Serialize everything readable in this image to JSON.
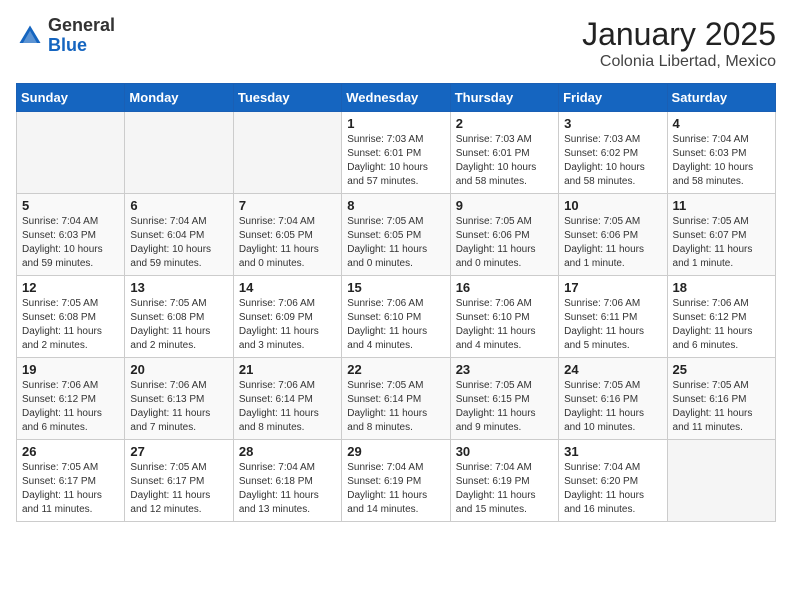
{
  "header": {
    "logo_general": "General",
    "logo_blue": "Blue",
    "month_title": "January 2025",
    "location": "Colonia Libertad, Mexico"
  },
  "weekdays": [
    "Sunday",
    "Monday",
    "Tuesday",
    "Wednesday",
    "Thursday",
    "Friday",
    "Saturday"
  ],
  "weeks": [
    [
      {
        "day": "",
        "info": ""
      },
      {
        "day": "",
        "info": ""
      },
      {
        "day": "",
        "info": ""
      },
      {
        "day": "1",
        "info": "Sunrise: 7:03 AM\nSunset: 6:01 PM\nDaylight: 10 hours and 57 minutes."
      },
      {
        "day": "2",
        "info": "Sunrise: 7:03 AM\nSunset: 6:01 PM\nDaylight: 10 hours and 58 minutes."
      },
      {
        "day": "3",
        "info": "Sunrise: 7:03 AM\nSunset: 6:02 PM\nDaylight: 10 hours and 58 minutes."
      },
      {
        "day": "4",
        "info": "Sunrise: 7:04 AM\nSunset: 6:03 PM\nDaylight: 10 hours and 58 minutes."
      }
    ],
    [
      {
        "day": "5",
        "info": "Sunrise: 7:04 AM\nSunset: 6:03 PM\nDaylight: 10 hours and 59 minutes."
      },
      {
        "day": "6",
        "info": "Sunrise: 7:04 AM\nSunset: 6:04 PM\nDaylight: 10 hours and 59 minutes."
      },
      {
        "day": "7",
        "info": "Sunrise: 7:04 AM\nSunset: 6:05 PM\nDaylight: 11 hours and 0 minutes."
      },
      {
        "day": "8",
        "info": "Sunrise: 7:05 AM\nSunset: 6:05 PM\nDaylight: 11 hours and 0 minutes."
      },
      {
        "day": "9",
        "info": "Sunrise: 7:05 AM\nSunset: 6:06 PM\nDaylight: 11 hours and 0 minutes."
      },
      {
        "day": "10",
        "info": "Sunrise: 7:05 AM\nSunset: 6:06 PM\nDaylight: 11 hours and 1 minute."
      },
      {
        "day": "11",
        "info": "Sunrise: 7:05 AM\nSunset: 6:07 PM\nDaylight: 11 hours and 1 minute."
      }
    ],
    [
      {
        "day": "12",
        "info": "Sunrise: 7:05 AM\nSunset: 6:08 PM\nDaylight: 11 hours and 2 minutes."
      },
      {
        "day": "13",
        "info": "Sunrise: 7:05 AM\nSunset: 6:08 PM\nDaylight: 11 hours and 2 minutes."
      },
      {
        "day": "14",
        "info": "Sunrise: 7:06 AM\nSunset: 6:09 PM\nDaylight: 11 hours and 3 minutes."
      },
      {
        "day": "15",
        "info": "Sunrise: 7:06 AM\nSunset: 6:10 PM\nDaylight: 11 hours and 4 minutes."
      },
      {
        "day": "16",
        "info": "Sunrise: 7:06 AM\nSunset: 6:10 PM\nDaylight: 11 hours and 4 minutes."
      },
      {
        "day": "17",
        "info": "Sunrise: 7:06 AM\nSunset: 6:11 PM\nDaylight: 11 hours and 5 minutes."
      },
      {
        "day": "18",
        "info": "Sunrise: 7:06 AM\nSunset: 6:12 PM\nDaylight: 11 hours and 6 minutes."
      }
    ],
    [
      {
        "day": "19",
        "info": "Sunrise: 7:06 AM\nSunset: 6:12 PM\nDaylight: 11 hours and 6 minutes."
      },
      {
        "day": "20",
        "info": "Sunrise: 7:06 AM\nSunset: 6:13 PM\nDaylight: 11 hours and 7 minutes."
      },
      {
        "day": "21",
        "info": "Sunrise: 7:06 AM\nSunset: 6:14 PM\nDaylight: 11 hours and 8 minutes."
      },
      {
        "day": "22",
        "info": "Sunrise: 7:05 AM\nSunset: 6:14 PM\nDaylight: 11 hours and 8 minutes."
      },
      {
        "day": "23",
        "info": "Sunrise: 7:05 AM\nSunset: 6:15 PM\nDaylight: 11 hours and 9 minutes."
      },
      {
        "day": "24",
        "info": "Sunrise: 7:05 AM\nSunset: 6:16 PM\nDaylight: 11 hours and 10 minutes."
      },
      {
        "day": "25",
        "info": "Sunrise: 7:05 AM\nSunset: 6:16 PM\nDaylight: 11 hours and 11 minutes."
      }
    ],
    [
      {
        "day": "26",
        "info": "Sunrise: 7:05 AM\nSunset: 6:17 PM\nDaylight: 11 hours and 11 minutes."
      },
      {
        "day": "27",
        "info": "Sunrise: 7:05 AM\nSunset: 6:17 PM\nDaylight: 11 hours and 12 minutes."
      },
      {
        "day": "28",
        "info": "Sunrise: 7:04 AM\nSunset: 6:18 PM\nDaylight: 11 hours and 13 minutes."
      },
      {
        "day": "29",
        "info": "Sunrise: 7:04 AM\nSunset: 6:19 PM\nDaylight: 11 hours and 14 minutes."
      },
      {
        "day": "30",
        "info": "Sunrise: 7:04 AM\nSunset: 6:19 PM\nDaylight: 11 hours and 15 minutes."
      },
      {
        "day": "31",
        "info": "Sunrise: 7:04 AM\nSunset: 6:20 PM\nDaylight: 11 hours and 16 minutes."
      },
      {
        "day": "",
        "info": ""
      }
    ]
  ]
}
